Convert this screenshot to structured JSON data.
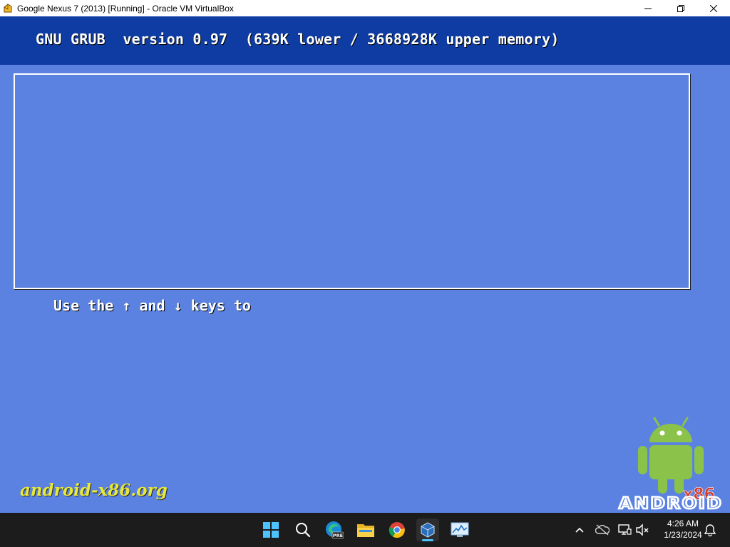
{
  "window": {
    "title": "Google Nexus 7 (2013) [Running] - Oracle VM VirtualBox",
    "icon": "virtualbox-window-icon",
    "controls": [
      "minimize",
      "maximize",
      "close"
    ]
  },
  "grub": {
    "header": "GNU GRUB  version 0.97  (639K lower / 3668928K upper memory)",
    "help_text": "Use the ↑ and ↓ keys to",
    "menu_entries": [],
    "colors": {
      "background": "#5b82e0",
      "header_background": "#0f3ca3",
      "text": "#ffffff"
    }
  },
  "branding": {
    "site_text": "android-x86.org",
    "site_text_color": "#e8e83a",
    "logo_badge": "x86",
    "logo_wordmark": "ANDROID",
    "robot_color": "#8bc34a"
  },
  "taskbar": {
    "apps": [
      {
        "name": "start-button",
        "icon": "windows-logo-icon"
      },
      {
        "name": "search-button",
        "icon": "search-icon"
      },
      {
        "name": "edge-preview",
        "icon": "edge-beta-icon",
        "badge": "PRE"
      },
      {
        "name": "file-explorer",
        "icon": "folder-icon"
      },
      {
        "name": "chrome",
        "icon": "chrome-icon"
      },
      {
        "name": "virtualbox",
        "icon": "virtualbox-icon",
        "active": true
      },
      {
        "name": "resource-monitor",
        "icon": "monitor-chart-icon"
      }
    ],
    "tray": {
      "icons": [
        "chevron-up-icon",
        "onedrive-offline-icon",
        "network-icon",
        "speaker-muted-icon"
      ],
      "time": "4:26 AM",
      "date": "1/23/2024",
      "notification_icon": "bell-icon"
    }
  }
}
